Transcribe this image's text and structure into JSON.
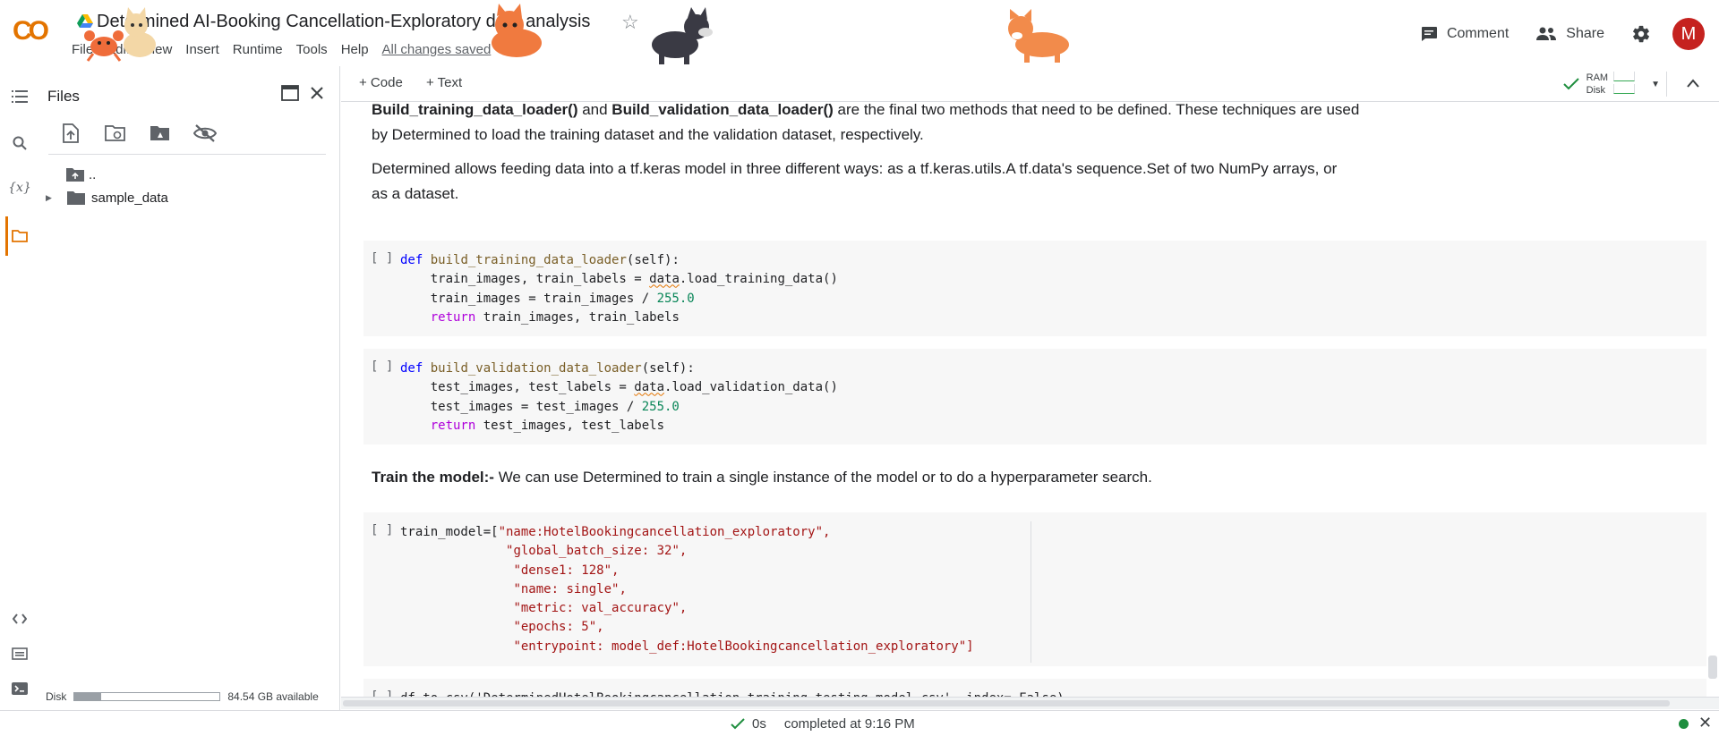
{
  "header": {
    "logo": "CO",
    "title": "Determined AI-Booking Cancellation-Exploratory data analysis",
    "menu": [
      "File",
      "Edit",
      "View",
      "Insert",
      "Runtime",
      "Tools",
      "Help"
    ],
    "saved_status": "All changes saved",
    "comment_label": "Comment",
    "share_label": "Share",
    "avatar_letter": "M"
  },
  "files": {
    "title": "Files",
    "tree": [
      {
        "name": ".."
      },
      {
        "name": "sample_data"
      }
    ],
    "disk_label": "Disk",
    "disk_available": "84.54 GB available",
    "disk_used_fraction": 0.18
  },
  "toolbar": {
    "code_label": "+ Code",
    "text_label": "+ Text",
    "ram_label": "RAM",
    "disk_label": "Disk"
  },
  "notebook": {
    "md1": {
      "part1_bold": "Build_training_data_loader()",
      "part2": " and ",
      "part3_bold": "Build_validation_data_loader()",
      "part4": " are the final two methods that need to be defined. These techniques are used",
      "line2": "by Determined to load the training dataset and the validation dataset, respectively."
    },
    "md2": {
      "line1": "Determined allows feeding data into a tf.keras model in three different ways: as a tf.keras.utils.A tf.data's sequence.Set of two NumPy arrays, or",
      "line2": "as a dataset."
    },
    "md3": {
      "bold": "Train the model:-",
      "text": " We can use Determined to train a single instance of the model or to do a hyperparameter search."
    },
    "cell_gutter": "[ ]",
    "cell1": {
      "def_kw": "def",
      "fn_name": "build_training_data_loader",
      "sig_rest": "(self):",
      "l2a": "    train_images, train_labels = ",
      "l2b": "data",
      "l2c": ".load_training_data()",
      "l3a": "    train_images = train_images / ",
      "l3num": "255.0",
      "ret_kw": "    return",
      "l4b": " train_images, train_labels"
    },
    "cell2": {
      "def_kw": "def",
      "fn_name": "build_validation_data_loader",
      "sig_rest": "(self):",
      "l2a": "    test_images, test_labels = ",
      "l2b": "data",
      "l2c": ".load_validation_data()",
      "l3a": "    test_images = test_images / ",
      "l3num": "255.0",
      "ret_kw": "    return",
      "l4b": " test_images, test_labels"
    },
    "cell3": {
      "prefix": "train_model=[",
      "items": [
        "\"name:HotelBookingcancellation_exploratory\",",
        "\"global_batch_size: 32\",",
        "\"dense1: 128\",",
        "\"name: single\",",
        "\"metric: val_accuracy\",",
        "\"epochs: 5\",",
        "\"entrypoint: model_def:HotelBookingcancellation_exploratory\"]"
      ]
    },
    "cell4": {
      "text": "df.to_csv('DeterminedHotelBookingcancellation_training_testing_model.csv', index= False)"
    }
  },
  "status": {
    "duration": "0s",
    "completed": "completed at 9:16 PM"
  }
}
